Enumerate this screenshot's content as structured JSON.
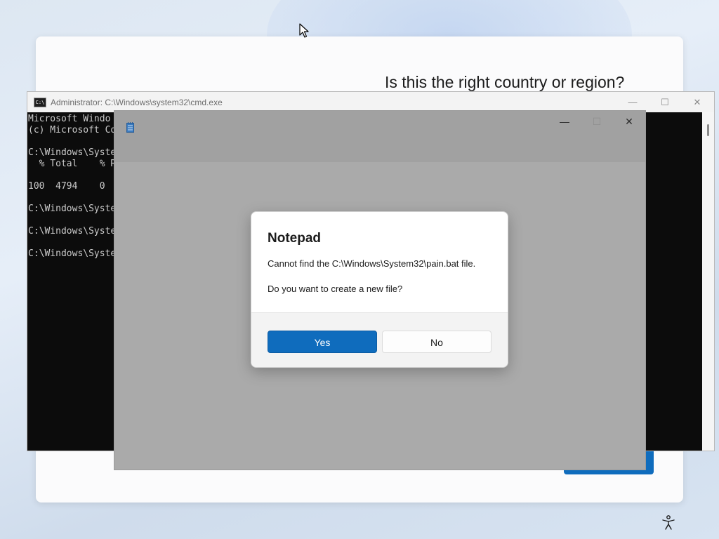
{
  "oobe": {
    "question": "Is this the right country or region?"
  },
  "cmd": {
    "icon_text": "C:\\",
    "title": "Administrator: C:\\Windows\\system32\\cmd.exe",
    "minimize": "—",
    "maximize": "☐",
    "close": "✕",
    "lines": [
      "Microsoft Windo",
      "(c) Microsoft Co",
      "",
      "C:\\Windows\\Syste",
      "  % Total    % R",
      "",
      "100  4794    0  ",
      "",
      "C:\\Windows\\Syste",
      "",
      "C:\\Windows\\Syste",
      "",
      "C:\\Windows\\Syste"
    ]
  },
  "notepad": {
    "icon": "notepad-icon",
    "minimize": "—",
    "maximize": "☐",
    "close": "✕"
  },
  "dialog": {
    "title": "Notepad",
    "message": "Cannot find the C:\\Windows\\System32\\pain.bat file.",
    "question": "Do you want to create a new file?",
    "yes_label": "Yes",
    "no_label": "No"
  },
  "colors": {
    "accent": "#0f6cbd",
    "console_bg": "#0c0c0c",
    "console_text": "#cccccc"
  }
}
